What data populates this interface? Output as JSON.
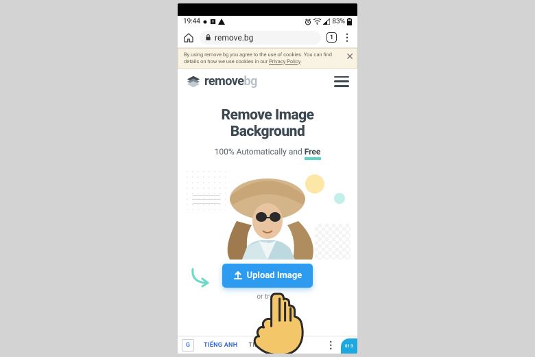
{
  "status": {
    "time": "19:44",
    "battery": "83%"
  },
  "browser": {
    "url_host": "remove.bg",
    "tab_count": "1"
  },
  "cookie": {
    "text_before": "By using remove.bg you agree to the use of cookies. You can find details on how we use cookies in our ",
    "link_label": "Privacy Policy",
    "text_after": "."
  },
  "logo": {
    "text_a": "remove",
    "text_b": "bg"
  },
  "hero": {
    "title_line1": "Remove Image",
    "title_line2": "Background",
    "subtitle_before": "100% Automatically and ",
    "free_label": "Free"
  },
  "cta": {
    "upload_label": "Upload Image",
    "try_text": "or try o"
  },
  "bottombar": {
    "lang1": "TIẾNG ANH",
    "lang2": "TIẾN",
    "side_label": "01:3"
  }
}
